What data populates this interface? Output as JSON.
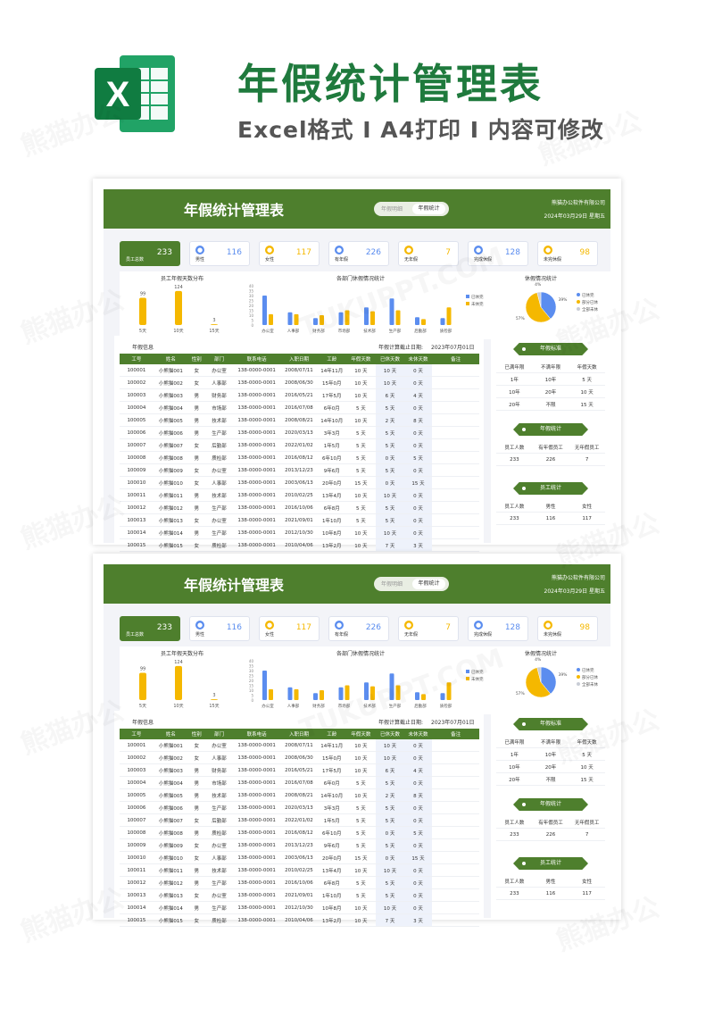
{
  "hero": {
    "title": "年假统计管理表",
    "subtitle": "Excel格式 I A4打印 I 内容可修改",
    "logo_letter": "X"
  },
  "sheet": {
    "title": "年假统计管理表",
    "toggle_left": "年假明细",
    "toggle_right": "年假统计",
    "company": "熊猫办公软件有限公司",
    "date": "2024年03月29日 星期五"
  },
  "kpis": [
    {
      "label": "员工总数",
      "value": "233",
      "icon": "user-icon",
      "color": "#4e7f2d"
    },
    {
      "label": "男性",
      "value": "116",
      "icon": "male-icon",
      "color": "#5b8def"
    },
    {
      "label": "女性",
      "value": "117",
      "icon": "female-icon",
      "color": "#f5b800"
    },
    {
      "label": "有年假",
      "value": "226",
      "icon": "calendar-icon",
      "color": "#5b8def"
    },
    {
      "label": "无年假",
      "value": "7",
      "icon": "lock-icon",
      "color": "#f5b800"
    },
    {
      "label": "完成休假",
      "value": "128",
      "icon": "check-icon",
      "color": "#5b8def"
    },
    {
      "label": "未完休假",
      "value": "98",
      "icon": "cross-icon",
      "color": "#f5b800"
    }
  ],
  "chart_data": [
    {
      "type": "bar",
      "title": "员工年假天数分布",
      "categories": [
        "5天",
        "10天",
        "15天"
      ],
      "values": [
        99,
        124,
        3
      ],
      "color": "#f5b800"
    },
    {
      "type": "bar",
      "title": "各部门休假情况统计",
      "categories": [
        "办公室",
        "人事部",
        "财务部",
        "市场部",
        "技术部",
        "生产部",
        "后勤部",
        "质检部"
      ],
      "series": [
        {
          "name": "已休完",
          "values": [
            30,
            13,
            7,
            13,
            18,
            27,
            8,
            7
          ],
          "color": "#5b8def"
        },
        {
          "name": "未休完",
          "values": [
            11,
            11,
            10,
            15,
            14,
            15,
            6,
            18
          ],
          "color": "#f5b800"
        }
      ],
      "ylim": [
        0,
        40
      ],
      "yticks": [
        "0",
        "5",
        "10",
        "15",
        "20",
        "25",
        "30",
        "35",
        "40"
      ]
    },
    {
      "type": "pie",
      "title": "休假情况统计",
      "categories": [
        "已休完",
        "部分已休",
        "全部未休"
      ],
      "values": [
        39,
        57,
        4
      ],
      "labels": [
        "39%",
        "57%",
        "4%"
      ],
      "colors": [
        "#5b8def",
        "#f5b800",
        "#c9cdd6"
      ]
    }
  ],
  "table": {
    "title": "年假信息",
    "cutoff_label": "年假计算截止日期:",
    "cutoff_date": "2023年07月01日",
    "headers": [
      "工号",
      "姓名",
      "性别",
      "部门",
      "联系电话",
      "入职日期",
      "工龄",
      "年假天数",
      "已休天数",
      "未休天数",
      "备注"
    ],
    "rows": [
      [
        "100001",
        "小熊猫001",
        "女",
        "办公室",
        "138-0000-0001",
        "2008/07/11",
        "14年11月",
        "10 天",
        "10 天",
        "0 天",
        ""
      ],
      [
        "100002",
        "小熊猫002",
        "女",
        "人事部",
        "138-0000-0001",
        "2008/06/30",
        "15年0月",
        "10 天",
        "10 天",
        "0 天",
        ""
      ],
      [
        "100003",
        "小熊猫003",
        "男",
        "财务部",
        "138-0000-0001",
        "2016/05/21",
        "17年5月",
        "10 天",
        "6 天",
        "4 天",
        ""
      ],
      [
        "100004",
        "小熊猫004",
        "男",
        "市场部",
        "138-0000-0001",
        "2016/07/08",
        "6年0月",
        "5 天",
        "5 天",
        "0 天",
        ""
      ],
      [
        "100005",
        "小熊猫005",
        "男",
        "技术部",
        "138-0000-0001",
        "2008/08/21",
        "14年10月",
        "10 天",
        "2 天",
        "8 天",
        ""
      ],
      [
        "100006",
        "小熊猫006",
        "男",
        "生产部",
        "138-0000-0001",
        "2020/03/13",
        "3年3月",
        "5 天",
        "5 天",
        "0 天",
        ""
      ],
      [
        "100007",
        "小熊猫007",
        "女",
        "后勤部",
        "138-0000-0001",
        "2022/01/02",
        "1年5月",
        "5 天",
        "5 天",
        "0 天",
        ""
      ],
      [
        "100008",
        "小熊猫008",
        "男",
        "质检部",
        "138-0000-0001",
        "2016/08/12",
        "6年10月",
        "5 天",
        "0 天",
        "5 天",
        ""
      ],
      [
        "100009",
        "小熊猫009",
        "女",
        "办公室",
        "138-0000-0001",
        "2013/12/23",
        "9年6月",
        "5 天",
        "5 天",
        "0 天",
        ""
      ],
      [
        "100010",
        "小熊猫010",
        "女",
        "人事部",
        "138-0000-0001",
        "2003/06/13",
        "20年0月",
        "15 天",
        "0 天",
        "15 天",
        ""
      ],
      [
        "100011",
        "小熊猫011",
        "男",
        "技术部",
        "138-0000-0001",
        "2010/02/25",
        "13年4月",
        "10 天",
        "10 天",
        "0 天",
        ""
      ],
      [
        "100012",
        "小熊猫012",
        "男",
        "生产部",
        "138-0000-0001",
        "2016/10/06",
        "6年8月",
        "5 天",
        "5 天",
        "0 天",
        ""
      ],
      [
        "100013",
        "小熊猫013",
        "女",
        "办公室",
        "138-0000-0001",
        "2021/09/01",
        "1年10月",
        "5 天",
        "5 天",
        "0 天",
        ""
      ],
      [
        "100014",
        "小熊猫014",
        "男",
        "生产部",
        "138-0000-0001",
        "2012/10/30",
        "10年8月",
        "10 天",
        "10 天",
        "0 天",
        ""
      ],
      [
        "100015",
        "小熊猫015",
        "女",
        "质检部",
        "138-0000-0001",
        "2010/04/06",
        "13年2月",
        "10 天",
        "7 天",
        "3 天",
        ""
      ]
    ]
  },
  "side": {
    "standard": {
      "title": "年假标准",
      "headers": [
        "已满年限",
        "",
        "不满年限",
        "",
        "年假天数"
      ],
      "rows": [
        [
          "1年",
          "10年",
          "5 天"
        ],
        [
          "10年",
          "20年",
          "10 天"
        ],
        [
          "20年",
          "不限",
          "15 天"
        ]
      ]
    },
    "annual": {
      "title": "年假统计",
      "headers": [
        "员工人数",
        "有年假员工",
        "无年假员工"
      ],
      "values": [
        "233",
        "226",
        "7"
      ]
    },
    "staff": {
      "title": "员工统计",
      "headers": [
        "员工人数",
        "男性",
        "女性"
      ],
      "values": [
        "233",
        "116",
        "117"
      ]
    }
  },
  "watermarks": [
    "熊猫办公",
    "TUKUPPT.COM"
  ]
}
